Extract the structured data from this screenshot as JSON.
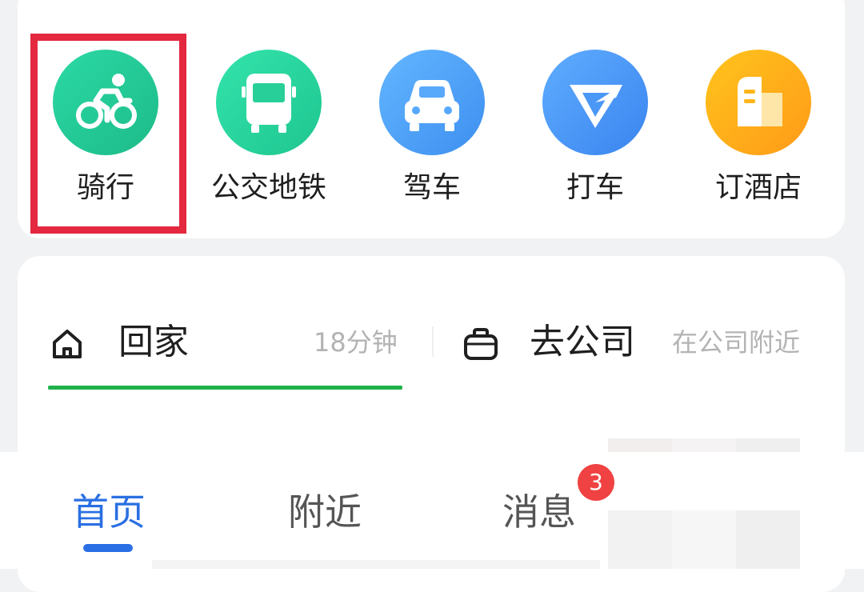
{
  "shortcuts": [
    {
      "label": "骑行",
      "icon": "bicycle-icon",
      "color_start": "#25d6a0",
      "color_end": "#1fbf8c"
    },
    {
      "label": "公交地铁",
      "icon": "bus-icon",
      "color_start": "#2fe0a6",
      "color_end": "#20c791"
    },
    {
      "label": "驾车",
      "icon": "car-icon",
      "color_start": "#5cb0ff",
      "color_end": "#3f93f2"
    },
    {
      "label": "打车",
      "icon": "taxi-logo-icon",
      "color_start": "#5aa8ff",
      "color_end": "#3b86f0"
    },
    {
      "label": "订酒店",
      "icon": "hotel-icon",
      "color_start": "#ffc21a",
      "color_end": "#ff9a1a"
    }
  ],
  "highlight": {
    "target": "骑行",
    "color": "#e3283f"
  },
  "commute": {
    "home": {
      "label": "回家",
      "time": "18分钟",
      "icon": "home-icon"
    },
    "work": {
      "label": "去公司",
      "status": "在公司附近",
      "icon": "briefcase-icon"
    },
    "active_underline_color": "#20b14a"
  },
  "bottom_nav": {
    "tabs": [
      {
        "label": "首页",
        "active": true
      },
      {
        "label": "附近",
        "active": false
      },
      {
        "label": "消息",
        "active": false
      }
    ],
    "badge": "3",
    "active_color": "#2a6fe3"
  }
}
